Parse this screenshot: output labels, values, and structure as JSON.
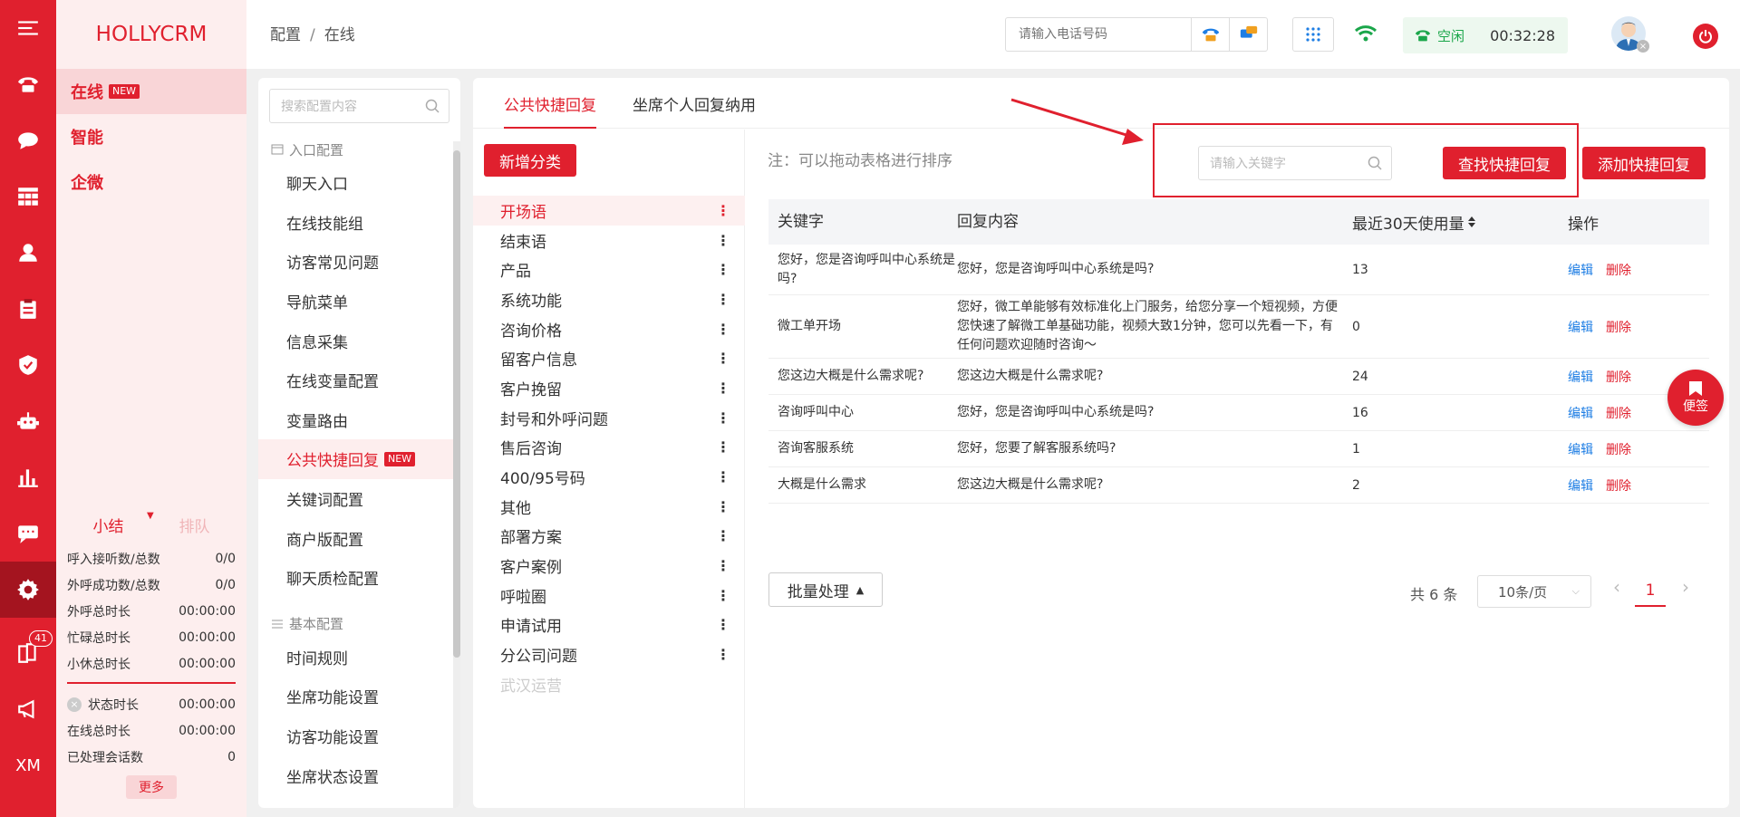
{
  "app": {
    "logo_text": "HOLLYCRM",
    "brand_color": "#e0202e"
  },
  "rail": {
    "icons": [
      "menu-icon",
      "phone-icon",
      "chat-icon",
      "grid-icon",
      "user-icon",
      "clipboard-icon",
      "shield-icon",
      "robot-icon",
      "bar-chart-icon",
      "message-icon",
      "settings-icon",
      "book-icon",
      "megaphone-icon"
    ],
    "active": "settings-icon",
    "book_badge": "41",
    "footer_text": "XM"
  },
  "left_menu": {
    "items": [
      {
        "label": "在线",
        "badge": "NEW"
      },
      {
        "label": "智能"
      },
      {
        "label": "企微"
      }
    ]
  },
  "stats": {
    "tab_summary": "小结",
    "tab_queue": "排队",
    "rows": [
      {
        "label": "呼入接听数/总数",
        "value": "0/0"
      },
      {
        "label": "外呼成功数/总数",
        "value": "0/0"
      },
      {
        "label": "外呼总时长",
        "value": "00:00:00"
      },
      {
        "label": "忙碌总时长",
        "value": "00:00:00"
      },
      {
        "label": "小休总时长",
        "value": "00:00:00"
      }
    ],
    "rows2": [
      {
        "label": "状态时长",
        "value": "00:00:00"
      },
      {
        "label": "在线总时长",
        "value": "00:00:00"
      },
      {
        "label": "已处理会话数",
        "value": "0"
      }
    ],
    "more": "更多"
  },
  "header": {
    "breadcrumb_1": "配置",
    "breadcrumb_sep": "/",
    "breadcrumb_2": "在线",
    "phone_placeholder": "请输入电话号码",
    "status_label": "空闲",
    "timer": "00:32:28"
  },
  "config": {
    "search_placeholder": "搜索配置内容",
    "group1": "入口配置",
    "group1_items": [
      {
        "label": "聊天入口"
      },
      {
        "label": "在线技能组"
      },
      {
        "label": "访客常见问题"
      },
      {
        "label": "导航菜单"
      },
      {
        "label": "信息采集"
      },
      {
        "label": "在线变量配置"
      },
      {
        "label": "变量路由"
      },
      {
        "label": "公共快捷回复",
        "badge": "NEW"
      },
      {
        "label": "关键词配置"
      },
      {
        "label": "商户版配置"
      },
      {
        "label": "聊天质检配置"
      }
    ],
    "group2": "基本配置",
    "group2_items": [
      {
        "label": "时间规则"
      },
      {
        "label": "坐席功能设置"
      },
      {
        "label": "访客功能设置"
      },
      {
        "label": "坐席状态设置"
      }
    ]
  },
  "main": {
    "tabs": [
      "公共快捷回复",
      "坐席个人回复纳用"
    ],
    "add_category": "新增分类",
    "categories": [
      "开场语",
      "结束语",
      "产品",
      "系统功能",
      "咨询价格",
      "留客户信息",
      "客户挽留",
      "封号和外呼问题",
      "售后咨询",
      "400/95号码",
      "其他",
      "部署方案",
      "客户案例",
      "呼啦圈",
      "申请试用",
      "分公司问题",
      "武汉运营"
    ],
    "note": "注：可以拖动表格进行排序",
    "keyword_placeholder": "请输入关键字",
    "search_button": "查找快捷回复",
    "add_button": "添加快捷回复",
    "columns": [
      "关键字",
      "回复内容",
      "最近30天使用量",
      "操作"
    ],
    "rows": [
      {
        "keyword": "您好，您是咨询呼叫中心系统是吗?",
        "content": "您好，您是咨询呼叫中心系统是吗?",
        "count": "13"
      },
      {
        "keyword": "微工单开场",
        "content": "您好，微工单能够有效标准化上门服务，给您分享一个短视频，方便您快速了解微工单基础功能，视频大致1分钟，您可以先看一下，有任何问题欢迎随时咨询～",
        "count": "0"
      },
      {
        "keyword": "您这边大概是什么需求呢?",
        "content": "您这边大概是什么需求呢?",
        "count": "24"
      },
      {
        "keyword": "咨询呼叫中心",
        "content": "您好，您是咨询呼叫中心系统是吗?",
        "count": "16"
      },
      {
        "keyword": "咨询客服系统",
        "content": "您好，您要了解客服系统吗?",
        "count": "1"
      },
      {
        "keyword": "大概是什么需求",
        "content": "您这边大概是什么需求呢?",
        "count": "2"
      }
    ],
    "edit_label": "编辑",
    "delete_label": "删除",
    "batch": "批量处理",
    "total": "共 6 条",
    "page_size": "10条/页",
    "page": "1",
    "sticky_label": "便签"
  }
}
